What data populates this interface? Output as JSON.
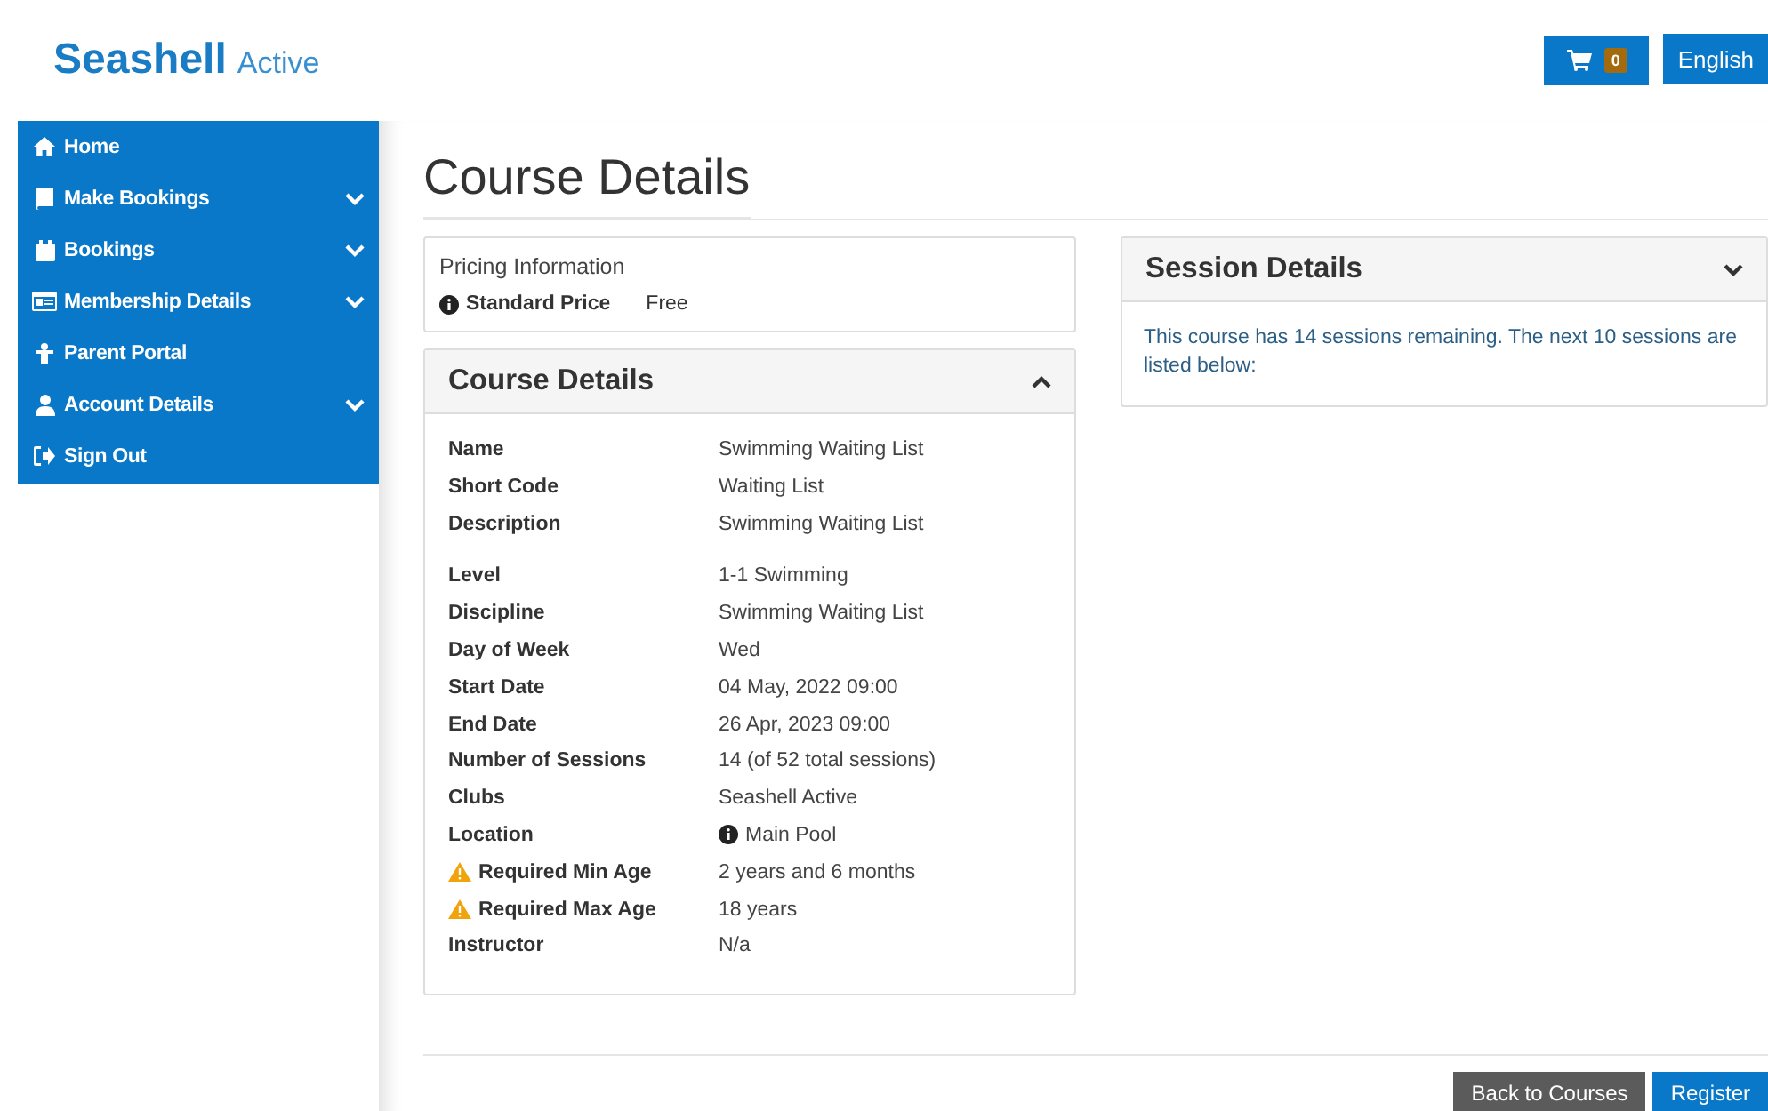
{
  "header": {
    "logo": {
      "brand": "Seashell",
      "suffix": "Active"
    },
    "cart": {
      "count": "0"
    },
    "language": "English"
  },
  "sidebar": {
    "items": [
      {
        "label": "Home",
        "expandable": false
      },
      {
        "label": "Make Bookings",
        "expandable": true
      },
      {
        "label": "Bookings",
        "expandable": true
      },
      {
        "label": "Membership Details",
        "expandable": true
      },
      {
        "label": "Parent Portal",
        "expandable": false
      },
      {
        "label": "Account Details",
        "expandable": true
      },
      {
        "label": "Sign Out",
        "expandable": false
      }
    ]
  },
  "page_title": "Course Details",
  "pricing": {
    "title": "Pricing Information",
    "label": "Standard Price",
    "value": "Free"
  },
  "course_details": {
    "title": "Course Details",
    "expanded": true,
    "groups": [
      [
        {
          "label": "Name",
          "value": "Swimming Waiting List"
        },
        {
          "label": "Short Code",
          "value": "Waiting List"
        },
        {
          "label": "Description",
          "value": "Swimming Waiting List"
        }
      ],
      [
        {
          "label": "Level",
          "value": "1-1 Swimming"
        },
        {
          "label": "Discipline",
          "value": "Swimming Waiting List"
        },
        {
          "label": "Day of Week",
          "value": "Wed"
        },
        {
          "label": "Start Date",
          "value": "04 May, 2022 09:00"
        },
        {
          "label": "End Date",
          "value": "26 Apr, 2023 09:00"
        },
        {
          "label": "Number of Sessions",
          "value": "14 (of 52 total sessions)"
        },
        {
          "label": "Clubs",
          "value": "Seashell Active"
        },
        {
          "label": "Location",
          "value": "Main Pool",
          "kind": "info"
        },
        {
          "label": "Required Min Age",
          "value": "2 years and 6 months",
          "kind": "warning"
        },
        {
          "label": "Required Max Age",
          "value": "18 years",
          "kind": "warning"
        },
        {
          "label": "Instructor",
          "value": "N/a"
        }
      ]
    ]
  },
  "session_details": {
    "title": "Session Details",
    "expanded": false,
    "text": "This course has 14 sessions remaining. The next 10 sessions are listed below:"
  },
  "buttons": [
    {
      "label": "Back to Courses",
      "kind": "secondary"
    },
    {
      "label": "Register",
      "kind": "primary"
    }
  ]
}
